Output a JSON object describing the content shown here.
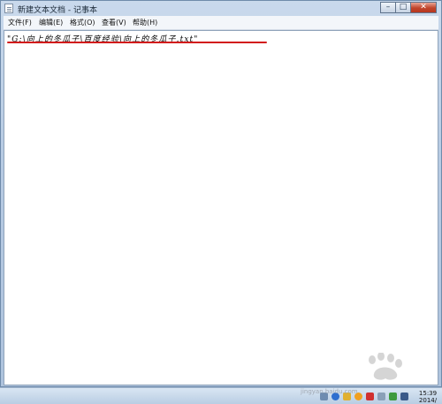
{
  "window": {
    "title": "新建文本文档 - 记事本",
    "minimize_icon": "minimize-icon",
    "maximize_icon": "maximize-icon",
    "close_icon": "close-icon"
  },
  "menu": {
    "items": [
      "文件(F)",
      "编辑(E)",
      "格式(O)",
      "查看(V)",
      "帮助(H)"
    ]
  },
  "editor": {
    "content": "\"G:\\向上的冬瓜子\\百度经验\\向上的冬瓜子.txt\"",
    "underline_color": "#d21a1a"
  },
  "taskbar": {
    "clock_time": "15:39",
    "clock_date": "2014/",
    "watermark_text": "jingyan.baidu.com",
    "tray_icons": [
      "network-icon",
      "help-icon",
      "flag-icon",
      "qq-icon",
      "security-icon",
      "volume-icon",
      "power-icon",
      "ime-icon"
    ]
  }
}
